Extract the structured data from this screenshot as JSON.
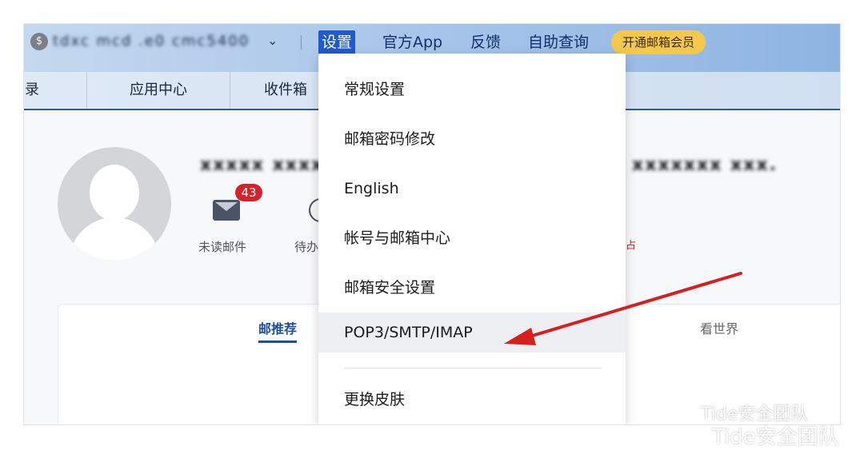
{
  "topbar": {
    "account_icon_glyph": "$",
    "account_icon": "account-switch-icon",
    "account_name": "tdxc mcd .e0 cmc5400",
    "caret_glyph": "⌄",
    "nav": {
      "settings": "设置",
      "official_app": "官方App",
      "feedback": "反馈",
      "self_service": "自助查询"
    },
    "vip_label": "开通邮箱会员",
    "vip_color": "#f4c84d",
    "active_color": "#1f5bc9"
  },
  "tabs": [
    "录",
    "应用中心",
    "收件箱"
  ],
  "profile": {
    "name": "xxxxx xxxx",
    "extra": "xxxxxxx xxx.",
    "unread_count": "43",
    "unread_label": "未读邮件",
    "todo_label": "待办",
    "red_fragment": "占"
  },
  "feed": {
    "tab_active": "邮推荐",
    "tab_other": "看世界"
  },
  "dropdown": {
    "items": [
      "常规设置",
      "邮箱密码修改",
      "English",
      "帐号与邮箱中心",
      "邮箱安全设置",
      "POP3/SMTP/IMAP",
      "更换皮肤"
    ],
    "highlighted_index": 5
  },
  "annotation": {
    "arrow_color": "#d61f1f",
    "points_to": "POP3/SMTP/IMAP"
  },
  "watermark": {
    "line1": "Tide安全团队",
    "line2": "Tide安全团队",
    "icon": "wechat-icon"
  }
}
